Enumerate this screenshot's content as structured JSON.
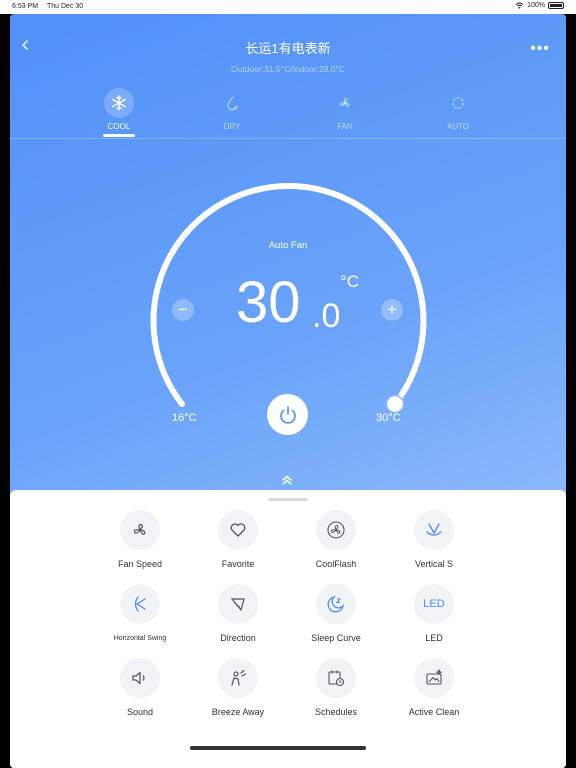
{
  "status_bar": {
    "time": "6:53 PM",
    "date": "Thu Dec 30",
    "battery": "100%",
    "icons": [
      "wifi-icon",
      "battery-icon"
    ]
  },
  "header": {
    "title": "长运1有电表新",
    "subtitle": "Outdoor:31.5°C/Indoor:29.0°C",
    "back_icon": "chevron-left-icon",
    "more_icon": "more-dots-icon"
  },
  "modes": [
    {
      "label": "COOL",
      "icon": "snowflake-icon",
      "active": true
    },
    {
      "label": "DRY",
      "icon": "droplet-icon",
      "active": false
    },
    {
      "label": "FAN",
      "icon": "fan-icon",
      "active": false
    },
    {
      "label": "AUTO",
      "icon": "auto-cycle-icon",
      "active": false
    }
  ],
  "dial": {
    "fan_mode": "Auto Fan",
    "temp_integer": "30",
    "temp_decimal": ".0",
    "unit": "°C",
    "min_label": "16°C",
    "max_label": "30°C",
    "minus": "−",
    "plus": "+",
    "setpoint_fraction": 1.0
  },
  "features": [
    {
      "label": "Fan Speed",
      "icon": "fan-speed-icon"
    },
    {
      "label": "Favorite",
      "icon": "heart-icon"
    },
    {
      "label": "CoolFlash",
      "icon": "coolflash-icon"
    },
    {
      "label": "Vertical S",
      "icon": "vertical-swing-icon"
    },
    {
      "label": "Horizontal Swing",
      "icon": "horizontal-swing-icon"
    },
    {
      "label": "Direction",
      "icon": "direction-icon"
    },
    {
      "label": "Sleep Curve",
      "icon": "moon-icon"
    },
    {
      "label": "LED",
      "icon": "led-icon",
      "icon_text": "LED"
    },
    {
      "label": "Sound",
      "icon": "speaker-icon"
    },
    {
      "label": "Breeze Away",
      "icon": "breeze-away-icon"
    },
    {
      "label": "Schedules",
      "icon": "calendar-clock-icon"
    },
    {
      "label": "Active Clean",
      "icon": "active-clean-icon"
    }
  ],
  "colors": {
    "accent": "#4a8cf7",
    "icon_gray": "#555555",
    "background_top": "#5090f8",
    "background_bottom": "#bcd7fc"
  }
}
